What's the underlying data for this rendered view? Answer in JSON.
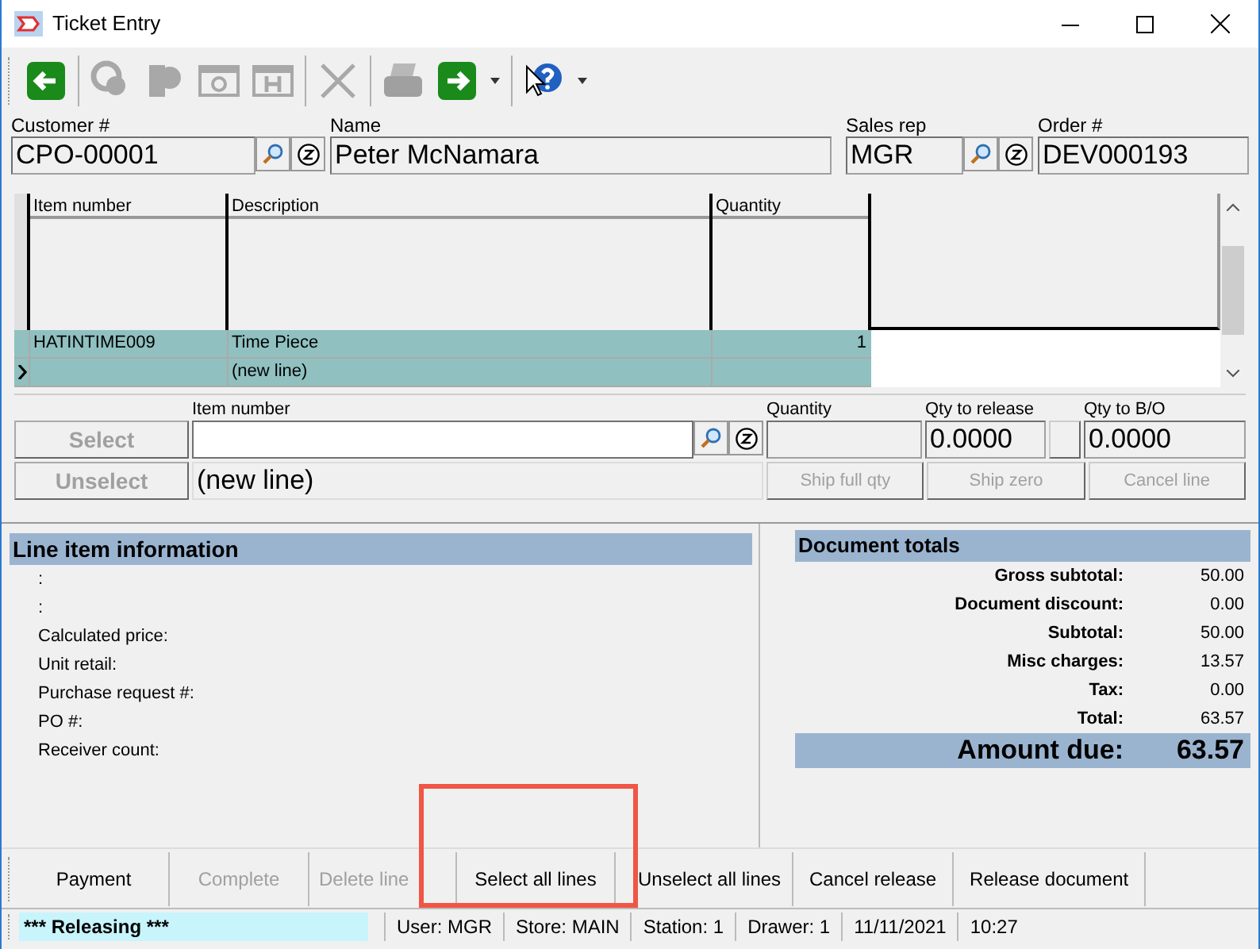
{
  "window": {
    "title": "Ticket Entry"
  },
  "toolbar": [
    {
      "disabled": false
    },
    {
      "disabled": true
    },
    {
      "disabled": true
    },
    {
      "disabled": true
    },
    {
      "disabled": true
    },
    {
      "disabled": true
    },
    {
      "disabled": true
    },
    {
      "disabled": false
    },
    {
      "disabled": false
    }
  ],
  "header": {
    "customer": {
      "label": "Customer #",
      "value": "CPO-00001"
    },
    "name": {
      "label": "Name",
      "value": "Peter McNamara"
    },
    "sales_rep": {
      "label": "Sales rep",
      "value": "MGR"
    },
    "order": {
      "label": "Order #",
      "value": "DEV000193"
    }
  },
  "grid": {
    "columns": [
      "Item number",
      "Description",
      "Quantity"
    ],
    "rows": [
      {
        "item_number": "HATINTIME009",
        "description": "Time Piece",
        "quantity": "1",
        "selected": false
      },
      {
        "description": "(new line)",
        "selected": true
      }
    ]
  },
  "entry": {
    "buttons": [
      {
        "label": "Select",
        "disabled": true
      },
      {
        "label": "Unselect",
        "disabled": true
      }
    ],
    "item_number_label": "Item number",
    "description": "(new line)",
    "quantity_label": "Quantity",
    "qty_to_release": {
      "label": "Qty to release",
      "value": "0.0000"
    },
    "qty_to_bo": {
      "label": "Qty to B/O",
      "value": "0.0000"
    },
    "line_buttons": [
      {
        "label": "Ship full qty",
        "disabled": true
      },
      {
        "label": "Ship zero",
        "disabled": true
      },
      {
        "label": "Cancel line",
        "disabled": true
      }
    ]
  },
  "line_info": {
    "title": "Line item information",
    "fields": [
      ":",
      ":",
      "Calculated price:",
      "Unit retail:",
      "Purchase request #:",
      "PO #:",
      "Receiver count:"
    ]
  },
  "totals": {
    "title": "Document totals",
    "rows": [
      {
        "label": "Gross subtotal:",
        "value": "50.00"
      },
      {
        "label": "Document discount:",
        "value": "0.00"
      },
      {
        "label": "Subtotal:",
        "value": "50.00"
      },
      {
        "label": "Misc charges:",
        "value": "13.57"
      },
      {
        "label": "Tax:",
        "value": "0.00"
      },
      {
        "label": "Total:",
        "value": "63.57"
      }
    ],
    "amount_due": {
      "label": "Amount due:",
      "value": "63.57"
    }
  },
  "actions": [
    {
      "label": "Payment",
      "disabled": false
    },
    {
      "label": "Complete",
      "disabled": true
    },
    {
      "label": "Delete line",
      "disabled": true
    },
    {
      "label": "Select all lines",
      "disabled": false
    },
    {
      "label": "Unselect all lines",
      "disabled": false
    },
    {
      "label": "Cancel release",
      "disabled": false
    },
    {
      "label": "Release document",
      "disabled": false
    }
  ],
  "status_bar": [
    {
      "text": "*** Releasing ***",
      "kind": "highlight"
    },
    {
      "text": "User: MGR",
      "kind": "plain"
    },
    {
      "text": "Store: MAIN",
      "kind": "plain"
    },
    {
      "text": "Station: 1",
      "kind": "plain"
    },
    {
      "text": "Drawer: 1",
      "kind": "plain"
    },
    {
      "text": "11/11/2021",
      "kind": "plain"
    },
    {
      "text": "10:27",
      "kind": "plain"
    }
  ]
}
